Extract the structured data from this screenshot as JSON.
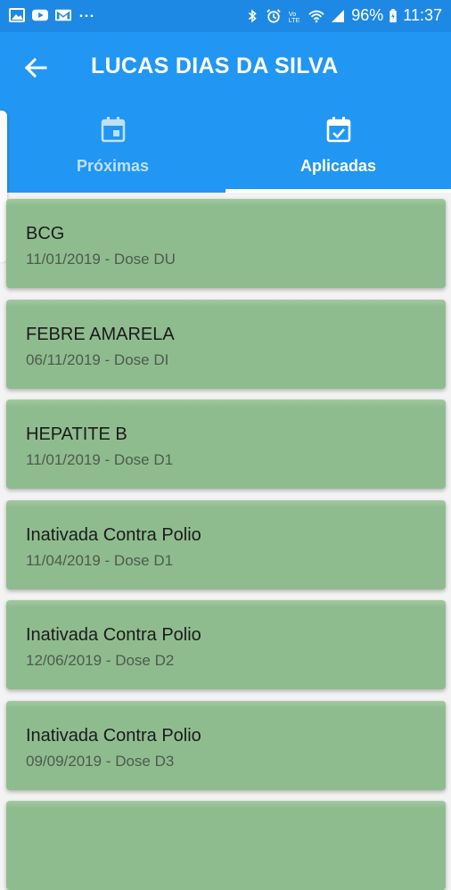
{
  "status_bar": {
    "battery": "96%",
    "time": "11:37",
    "colors": {
      "bar": "#1e88e5"
    }
  },
  "header": {
    "title": "LUCAS DIAS DA SILVA"
  },
  "tabs": [
    {
      "label": "Próximas",
      "icon": "calendar-icon",
      "active": false
    },
    {
      "label": "Aplicadas",
      "icon": "calendar-check-icon",
      "active": true
    }
  ],
  "vaccines": [
    {
      "name": "BCG",
      "detail": "11/01/2019 - Dose DU"
    },
    {
      "name": "FEBRE AMARELA",
      "detail": "06/11/2019 - Dose DI"
    },
    {
      "name": "HEPATITE B",
      "detail": "11/01/2019 - Dose D1"
    },
    {
      "name": "Inativada Contra Polio",
      "detail": "11/04/2019 - Dose D1"
    },
    {
      "name": "Inativada Contra Polio",
      "detail": "12/06/2019 - Dose D2"
    },
    {
      "name": "Inativada Contra Polio",
      "detail": "09/09/2019 - Dose D3"
    }
  ],
  "colors": {
    "primary": "#2196f3",
    "card": "#8fbc8f",
    "background": "#f3f3f3"
  }
}
